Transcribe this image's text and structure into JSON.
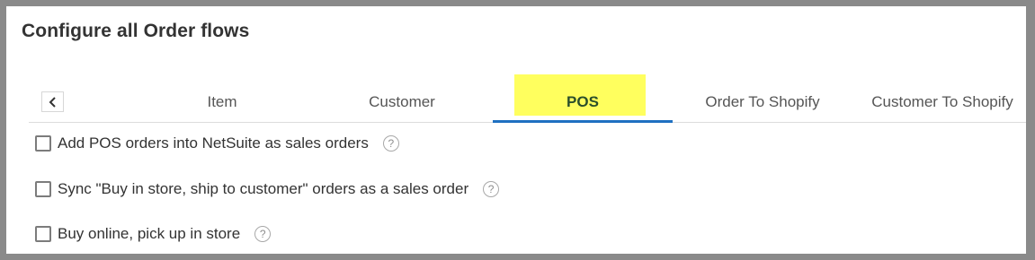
{
  "page": {
    "title": "Configure all Order flows"
  },
  "tabs": {
    "prev_icon": "chevron-left-icon",
    "items": [
      {
        "label": "Item",
        "active": false
      },
      {
        "label": "Customer",
        "active": false
      },
      {
        "label": "POS",
        "active": true,
        "highlight_color": "#ffff4d"
      },
      {
        "label": "Order To Shopify",
        "active": false
      },
      {
        "label": "Customer To Shopify",
        "active": false
      }
    ],
    "active_indicator_color": "#1f70c1"
  },
  "options": [
    {
      "label": "Add POS orders into NetSuite as sales orders",
      "checked": false,
      "help": "?"
    },
    {
      "label": "Sync \"Buy in store, ship to customer\" orders as a sales order",
      "checked": false,
      "help": "?"
    },
    {
      "label": "Buy online, pick up in store",
      "checked": false,
      "help": "?"
    }
  ]
}
